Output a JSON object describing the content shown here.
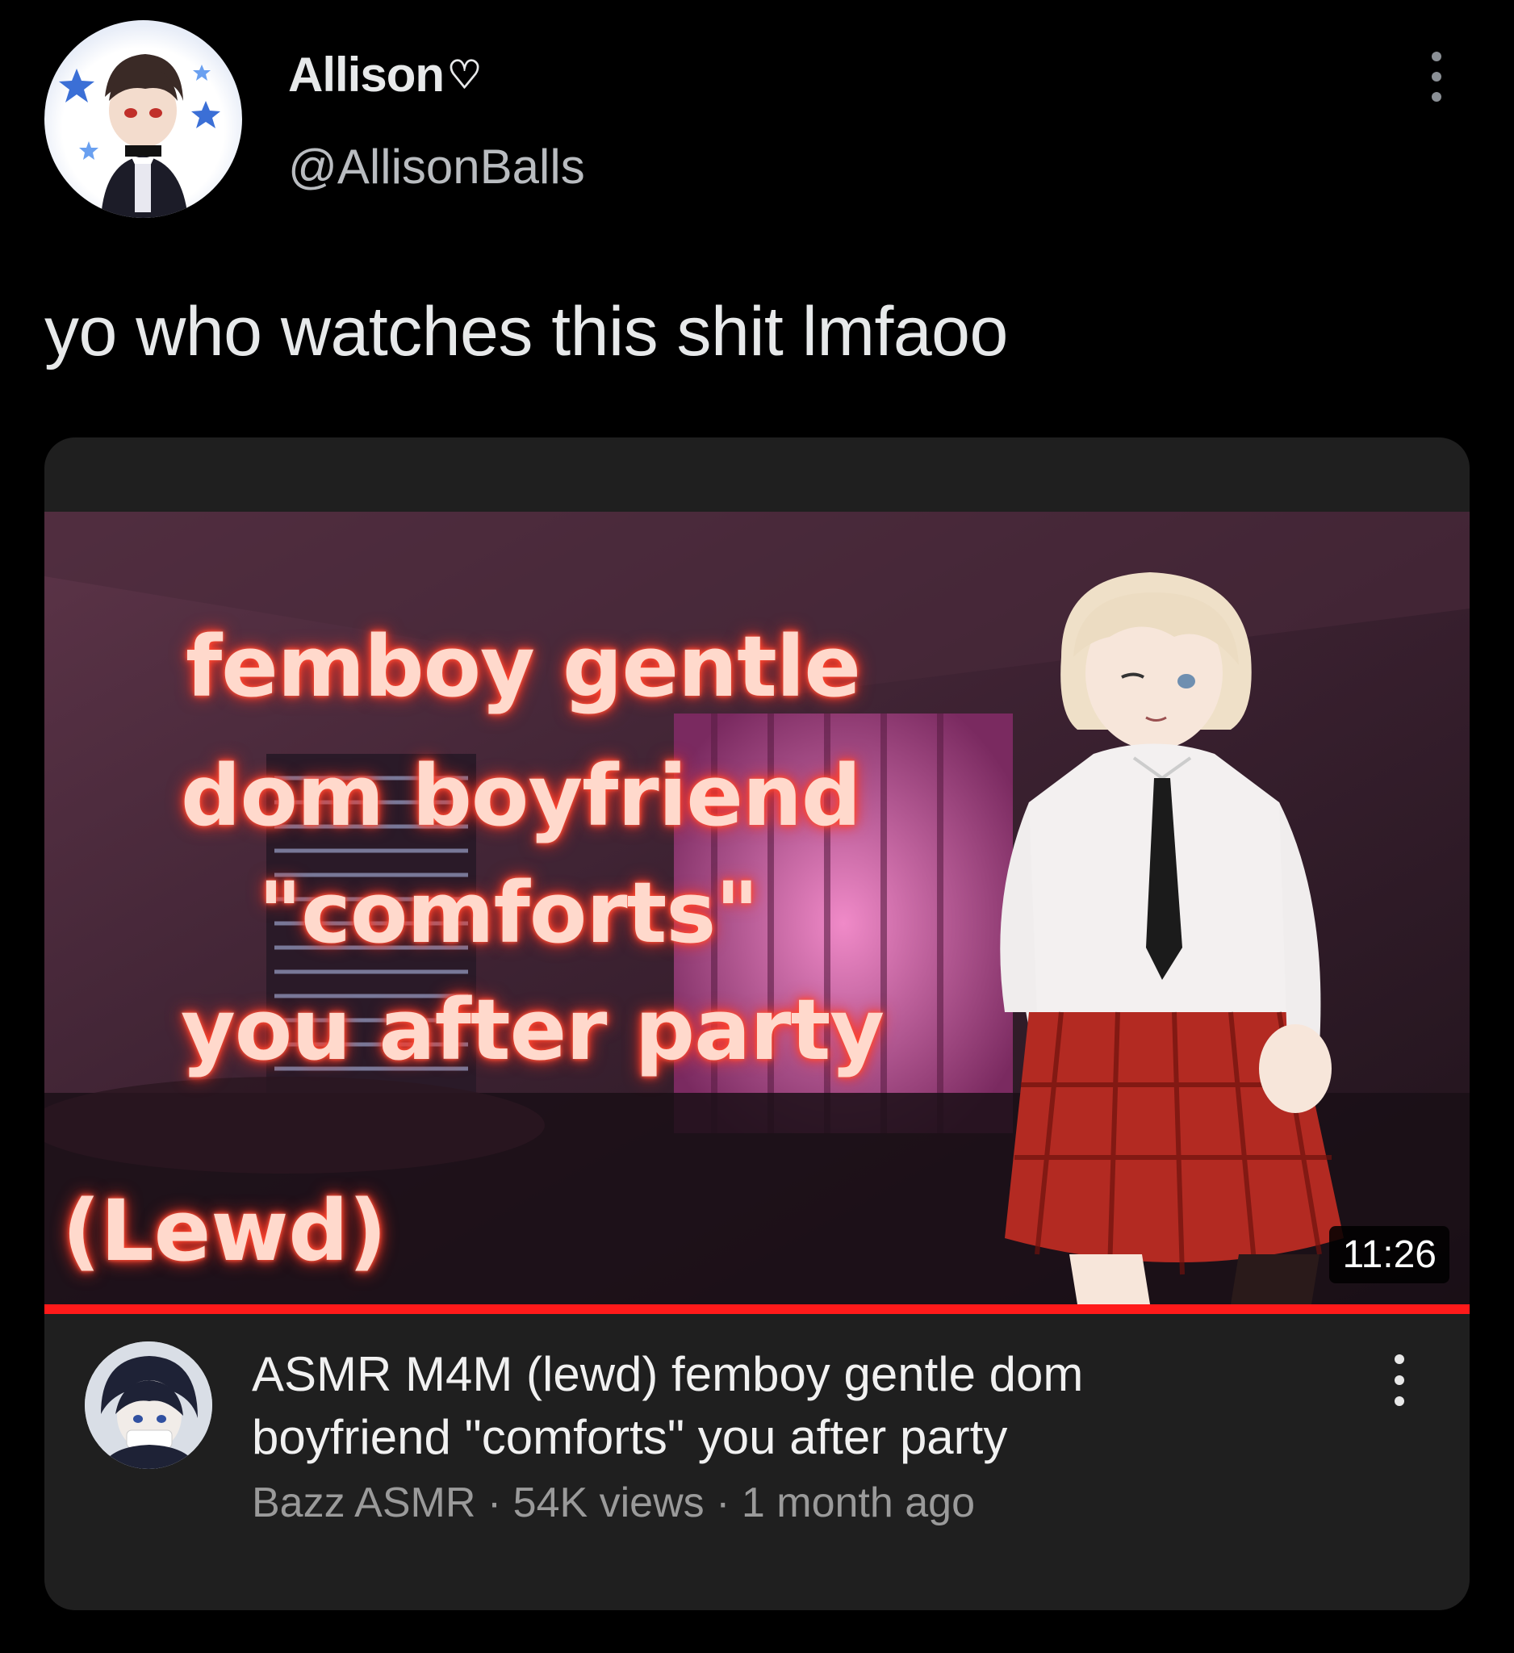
{
  "tweet": {
    "display_name": "Allison",
    "name_icon": "heart-outline-icon",
    "handle": "@AllisonBalls",
    "text": "yo who watches this shit lmfaoo",
    "more_icon": "vertical-dots-icon"
  },
  "video": {
    "thumbnail_lines": [
      "femboy gentle",
      "dom boyfriend",
      "\"comforts\"",
      "you after party"
    ],
    "thumbnail_tag": "(Lewd)",
    "duration": "11:26",
    "progress_fraction": 1.0,
    "title": "ASMR M4M (lewd) femboy gentle dom boyfriend \"comforts\" you after party",
    "channel": "Bazz ASMR",
    "views": "54K views",
    "age": "1 month ago",
    "separator": "·",
    "more_icon": "vertical-dots-icon"
  },
  "colors": {
    "background": "#000000",
    "card": "#1f1f1f",
    "progress": "#ff1a1a",
    "thumb_text": "#ffd9cc",
    "thumb_glow": "#ff3020"
  }
}
